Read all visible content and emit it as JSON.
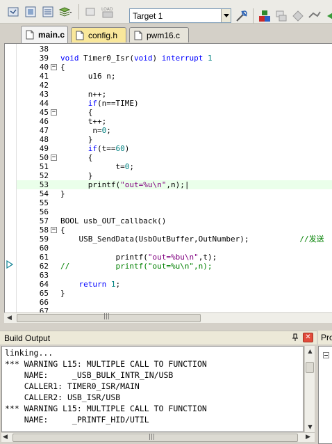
{
  "toolbar": {
    "target_value": "Target 1",
    "icons": [
      "build-target-icon",
      "rebuild-icon",
      "batch-build-icon",
      "download-load-icon",
      "target-options-icon",
      "select-packs-icon",
      "manage-components-icon"
    ]
  },
  "tabs": [
    {
      "label": "main.c",
      "active": true
    },
    {
      "label": "config.h",
      "active": false
    },
    {
      "label": "pwm16.c",
      "active": false
    }
  ],
  "editor": {
    "lines": [
      {
        "n": "38",
        "fold": "",
        "t": ""
      },
      {
        "n": "39",
        "fold": "",
        "t": "void Timer0_Isr(void) interrupt 1"
      },
      {
        "n": "40",
        "fold": "⊟",
        "t": "{"
      },
      {
        "n": "41",
        "fold": "",
        "t": "      u16 n;"
      },
      {
        "n": "42",
        "fold": "",
        "t": ""
      },
      {
        "n": "43",
        "fold": "",
        "t": "      n++;"
      },
      {
        "n": "44",
        "fold": "",
        "t": "      if(n==TIME)"
      },
      {
        "n": "45",
        "fold": "⊟",
        "t": "      {"
      },
      {
        "n": "46",
        "fold": "",
        "t": "      t++;"
      },
      {
        "n": "47",
        "fold": "",
        "t": "       n=0;"
      },
      {
        "n": "48",
        "fold": "",
        "t": "      }"
      },
      {
        "n": "49",
        "fold": "",
        "t": "      if(t==60)"
      },
      {
        "n": "50",
        "fold": "⊟",
        "t": "      {"
      },
      {
        "n": "51",
        "fold": "",
        "t": "            t=0;"
      },
      {
        "n": "52",
        "fold": "",
        "t": "      }"
      },
      {
        "n": "53",
        "fold": "",
        "t": "      printf(\"out=%u\\n\",n);|"
      },
      {
        "n": "54",
        "fold": "",
        "t": "}"
      },
      {
        "n": "55",
        "fold": "",
        "t": ""
      },
      {
        "n": "56",
        "fold": "",
        "t": ""
      },
      {
        "n": "57",
        "fold": "",
        "t": "BOOL usb_OUT_callback()"
      },
      {
        "n": "58",
        "fold": "⊟",
        "t": "{"
      },
      {
        "n": "59",
        "fold": "",
        "t": "    USB_SendData(UsbOutBuffer,OutNumber);           //发送"
      },
      {
        "n": "60",
        "fold": "",
        "t": ""
      },
      {
        "n": "61",
        "fold": "",
        "t": "            printf(\"out=%bu\\n\",t);"
      },
      {
        "n": "62",
        "fold": "",
        "t": "//          printf(\"out=%u\\n\",n);"
      },
      {
        "n": "63",
        "fold": "",
        "t": ""
      },
      {
        "n": "64",
        "fold": "",
        "t": "    return 1;"
      },
      {
        "n": "65",
        "fold": "",
        "t": "}"
      },
      {
        "n": "66",
        "fold": "",
        "t": ""
      },
      {
        "n": "67",
        "fold": "",
        "t": ""
      }
    ]
  },
  "build_output": {
    "title": "Build Output",
    "lines": [
      "linking...",
      "*** WARNING L15: MULTIPLE CALL TO FUNCTION",
      "    NAME:     _USB_BULK_INTR_IN/USB",
      "    CALLER1: TIMER0_ISR/MAIN",
      "    CALLER2: USB_ISR/USB",
      "*** WARNING L15: MULTIPLE CALL TO FUNCTION",
      "    NAME:     _PRINTF_HID/UTIL"
    ]
  },
  "right_panel": {
    "title": "Pro"
  },
  "colors": {
    "keyword": "#0000ff",
    "number": "#008080",
    "string": "#800080",
    "comment": "#008000",
    "highlight": "#eaffea"
  }
}
